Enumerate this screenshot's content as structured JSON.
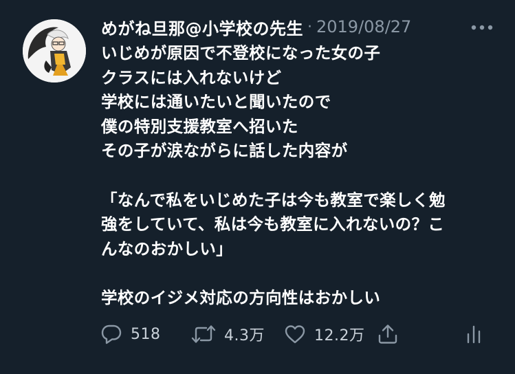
{
  "tweet": {
    "display_name": "めがね旦那@小学校の先生",
    "separator": "·",
    "date": "2019/08/27",
    "body_lines": [
      "いじめが原因で不登校になった女の子",
      "クラスには入れないけど",
      "学校には通いたいと聞いたので",
      "僕の特別支援教室へ招いた",
      "その子が涙ながらに話した内容が",
      "",
      "「なんで私をいじめた子は今も教室で楽しく勉",
      "強をしていて、私は今も教室に入れないの？こ",
      "んなのおかしい」",
      "",
      "学校のイジメ対応の方向性はおかしい"
    ]
  },
  "actions": {
    "reply_count": "518",
    "retweet_count": "4.3万",
    "like_count": "12.2万"
  },
  "icons": {
    "more": "more-dots-icon",
    "reply": "reply-icon",
    "retweet": "retweet-icon",
    "like": "heart-icon",
    "share": "share-icon",
    "analytics": "analytics-icon"
  },
  "colors": {
    "background": "#15202b",
    "text": "#ffffff",
    "muted": "#8b98a5"
  }
}
